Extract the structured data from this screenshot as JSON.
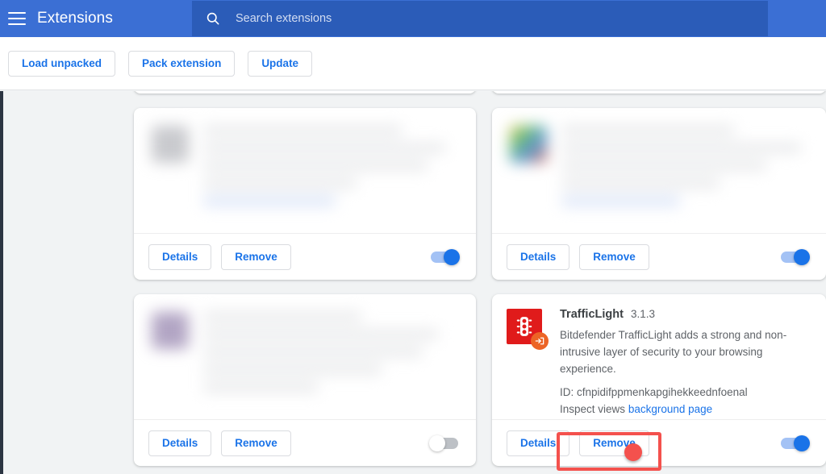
{
  "header": {
    "menu_icon": "hamburger-menu-icon",
    "title": "Extensions",
    "search": {
      "icon": "search-icon",
      "placeholder": "Search extensions",
      "value": ""
    }
  },
  "toolbar": {
    "buttons": [
      {
        "label": "Load unpacked",
        "name": "load-unpacked-button"
      },
      {
        "label": "Pack extension",
        "name": "pack-extension-button"
      },
      {
        "label": "Update",
        "name": "update-button"
      }
    ]
  },
  "card_actions": {
    "details_label": "Details",
    "remove_label": "Remove"
  },
  "cards": [
    {
      "id": "card-partial-left",
      "state": "partial-cut-off",
      "obscured": true
    },
    {
      "id": "card-partial-right",
      "state": "partial-cut-off",
      "obscured": true
    },
    {
      "id": "card-blurred-1",
      "obscured": true,
      "icon_color": "#c9cace",
      "enabled": true
    },
    {
      "id": "card-blurred-2",
      "obscured": true,
      "icon_color": "#8fb6e0",
      "enabled": true
    },
    {
      "id": "card-blurred-3",
      "obscured": true,
      "icon_color": "#b2a5c4",
      "enabled": false
    },
    {
      "id": "card-trafficlight",
      "obscured": false,
      "name": "TrafficLight",
      "version": "3.1.3",
      "description": "Bitdefender TrafficLight adds a strong and non-intrusive layer of security to your browsing experience.",
      "id_label": "ID: cfnpidifppmenkapgihekkeednfoenal",
      "inspect_label": "Inspect views",
      "inspect_link": "background page",
      "icon_name": "traffic-light-icon",
      "badge_icon": "sign-in-arrow-icon",
      "enabled": true
    }
  ],
  "annotation": {
    "highlight_target": "Remove",
    "dot_color": "#f4514d",
    "box_color": "#f4514d"
  },
  "colors": {
    "header_blue": "#3b6fd4",
    "search_blue": "#2b5cb8",
    "link_blue": "#1a73e8",
    "page_bg": "#f1f3f4",
    "ext_icon_red": "#e01b1b",
    "ext_badge_orange": "#ec6426"
  }
}
